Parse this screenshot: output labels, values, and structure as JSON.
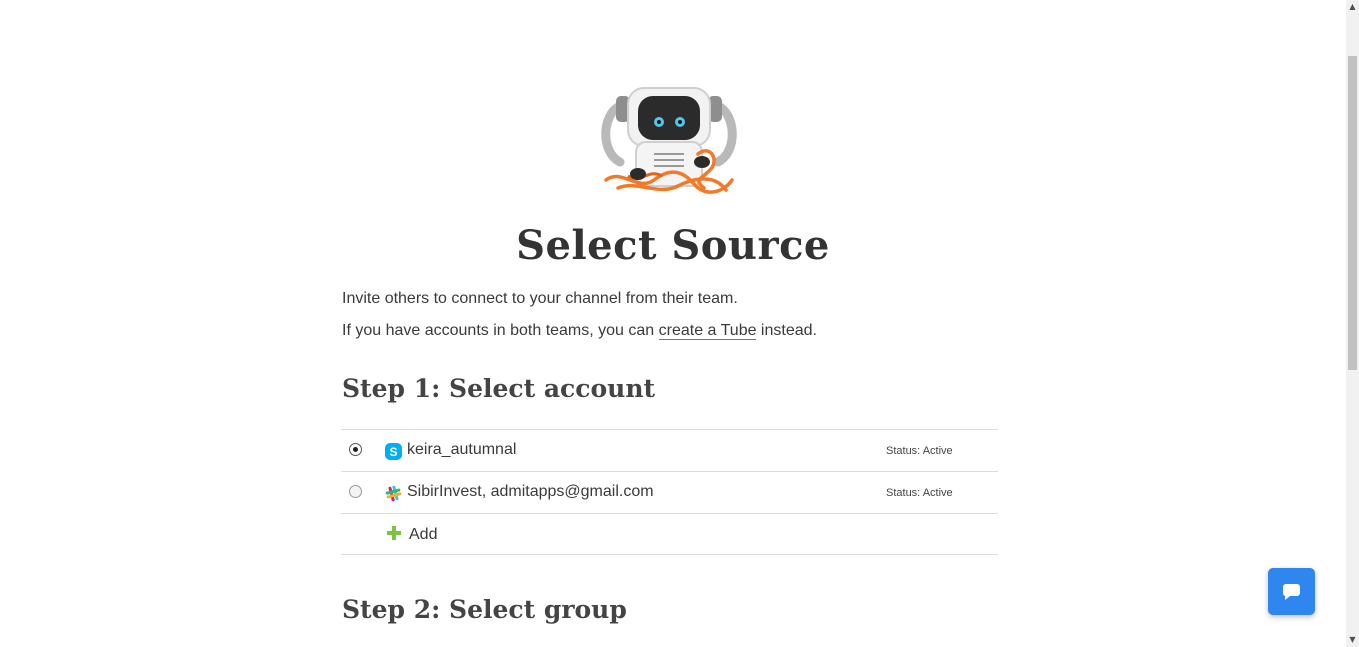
{
  "header": {
    "title": "Select Source",
    "intro_line1": "Invite others to connect to your channel from their team.",
    "intro_line2_before": "If you have accounts in both teams, you can ",
    "intro_line2_link": "create a Tube",
    "intro_line2_after": " instead."
  },
  "step1": {
    "title": "Step 1: Select account",
    "accounts": [
      {
        "service_icon": "skype-icon",
        "name": "keira_autumnal",
        "status": "Status: Active",
        "selected": true
      },
      {
        "service_icon": "slack-icon",
        "name": "SibirInvest, admitapps@gmail.com",
        "status": "Status: Active",
        "selected": false
      }
    ],
    "add_label": "Add"
  },
  "step2": {
    "title": "Step 2: Select group"
  },
  "icons": {
    "robot": "robot-mascot-icon",
    "chat": "chat-bubble-icon",
    "plus": "plus-icon"
  },
  "colors": {
    "accent_blue": "#2e86ee",
    "add_green": "#7dc242",
    "skype_blue": "#00aff0"
  }
}
